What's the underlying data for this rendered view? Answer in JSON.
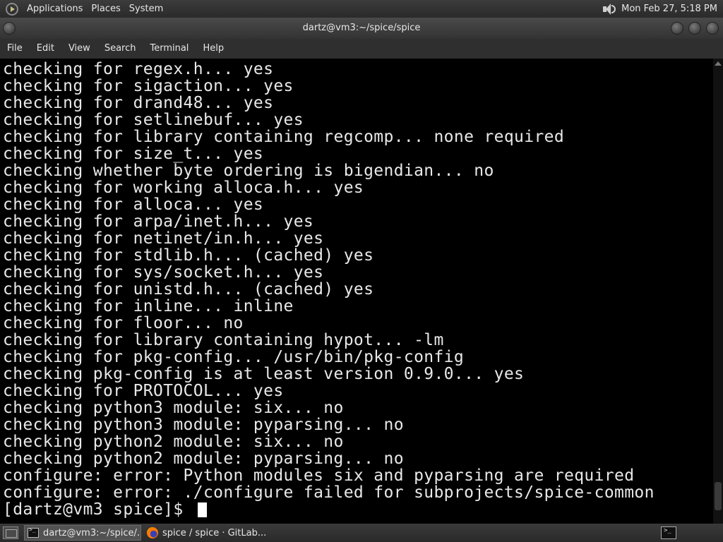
{
  "top_panel": {
    "menus": [
      "Applications",
      "Places",
      "System"
    ],
    "clock": "Mon Feb 27,  5:18 PM"
  },
  "window": {
    "title": "dartz@vm3:~/spice/spice"
  },
  "menubar": [
    "File",
    "Edit",
    "View",
    "Search",
    "Terminal",
    "Help"
  ],
  "terminal": {
    "lines": [
      "checking for regex.h... yes",
      "checking for sigaction... yes",
      "checking for drand48... yes",
      "checking for setlinebuf... yes",
      "checking for library containing regcomp... none required",
      "checking for size_t... yes",
      "checking whether byte ordering is bigendian... no",
      "checking for working alloca.h... yes",
      "checking for alloca... yes",
      "checking for arpa/inet.h... yes",
      "checking for netinet/in.h... yes",
      "checking for stdlib.h... (cached) yes",
      "checking for sys/socket.h... yes",
      "checking for unistd.h... (cached) yes",
      "checking for inline... inline",
      "checking for floor... no",
      "checking for library containing hypot... -lm",
      "checking for pkg-config... /usr/bin/pkg-config",
      "checking pkg-config is at least version 0.9.0... yes",
      "checking for PROTOCOL... yes",
      "checking python3 module: six... no",
      "checking python3 module: pyparsing... no",
      "checking python2 module: six... no",
      "checking python2 module: pyparsing... no",
      "configure: error: Python modules six and pyparsing are required",
      "configure: error: ./configure failed for subprojects/spice-common"
    ],
    "prompt": "[dartz@vm3 spice]$ "
  },
  "taskbar": {
    "tasks": [
      {
        "label": "dartz@vm3:~/spice/...",
        "icon": "terminal-icon"
      },
      {
        "label": "spice / spice · GitLab...",
        "icon": "firefox-icon"
      }
    ]
  }
}
